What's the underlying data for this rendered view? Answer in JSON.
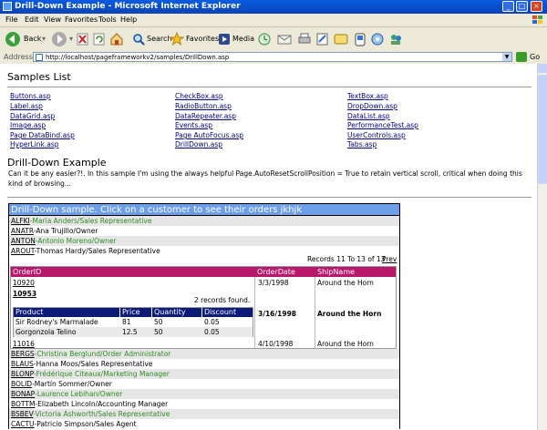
{
  "window": {
    "title": "Drill-Down Example - Microsoft Internet Explorer"
  },
  "menu": [
    "File",
    "Edit",
    "View",
    "Favorites",
    "Tools",
    "Help"
  ],
  "toolbar": {
    "back": "Back",
    "search": "Search",
    "favorites": "Favorites",
    "media": "Media"
  },
  "address": {
    "label": "Address",
    "url": "http://localhost/pageframeworkv2/samples/DrillDown.asp",
    "go": "Go"
  },
  "samples": {
    "heading": "Samples List",
    "col1": [
      "Buttons.asp",
      "Label.asp",
      "DataGrid.asp",
      "Image.asp",
      "Page DataBind.asp",
      "HyperLink.asp"
    ],
    "col2": [
      "CheckBox.asp",
      "RadioButton.asp",
      "DataRepeater.asp",
      "Events.asp",
      "Page AutoFocus.asp",
      "DrillDown.asp"
    ],
    "col3": [
      "TextBox.asp",
      "DropDown.asp",
      "DataList.asp",
      "PerformanceTest.asp",
      "UserControls.asp",
      "Tabs.asp"
    ]
  },
  "drill": {
    "heading": "Drill-Down Example",
    "description": "Can it be any easier?!. In this sample I'm using the always helpful Page.AutoResetScrollPosition = True to retain vertical scroll, critical when doing this kind of browsing...",
    "banner": "Drill-Down sample. Click on a customer to see their orders jkhjk"
  },
  "customers_top": [
    {
      "id": "ALFKI",
      "name": "-Maria Anders/Sales Representative"
    },
    {
      "id": "ANATR",
      "name": "-Ana Trujillo/Owner"
    },
    {
      "id": "ANTON",
      "name": "-Antonio Moreno/Owner"
    },
    {
      "id": "AROUT",
      "name": "-Thomas Hardy/Sales Representative"
    }
  ],
  "orders": {
    "records_text": "Records 11 To 13 of 13",
    "prev": "Prev",
    "headers": [
      "OrderID",
      "OrderDate",
      "ShipName"
    ],
    "rows": [
      {
        "id": "10920",
        "date": "3/3/1998",
        "ship": "Around the Horn"
      },
      {
        "id": "10953",
        "date": "3/16/1998",
        "ship": "Around the Horn"
      },
      {
        "id": "11016",
        "date": "4/10/1998",
        "ship": "Around the Horn"
      }
    ],
    "products": {
      "found": "2 records found.",
      "headers": [
        "Product",
        "Price",
        "Quantity",
        "Discount"
      ],
      "rows": [
        [
          "Sir Rodney's Marmalade",
          "81",
          "50",
          "0.05"
        ],
        [
          "Gorgonzola Telino",
          "12.5",
          "50",
          "0.05"
        ]
      ]
    }
  },
  "customers_bottom": [
    {
      "id": "BERGS",
      "name": "-Christina Berglund/Order Administrator"
    },
    {
      "id": "BLAUS",
      "name": "-Hanna Moos/Sales Representative"
    },
    {
      "id": "BLONP",
      "name": "-Frédérique Citeaux/Marketing Manager"
    },
    {
      "id": "BOLID",
      "name": "-Martín Sommer/Owner"
    },
    {
      "id": "BONAP",
      "name": "-Laurence Lebihan/Owner"
    },
    {
      "id": "BOTTM",
      "name": "-Elizabeth Lincoln/Accounting Manager"
    },
    {
      "id": "BSBEV",
      "name": "-Victoria Ashworth/Sales Representative"
    },
    {
      "id": "CACTU",
      "name": "-Patricio Simpson/Sales Agent"
    }
  ]
}
